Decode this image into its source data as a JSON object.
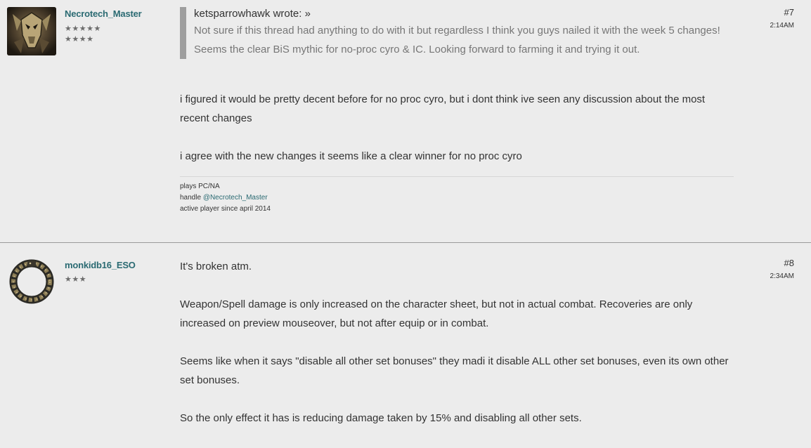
{
  "posts": [
    {
      "username": "Necrotech_Master",
      "rank_stars_row1": "★★★★★",
      "rank_stars_row2": "★★★★",
      "post_number": "#7",
      "time": "2:14AM",
      "quote": {
        "author": "ketsparrowhawk",
        "wrote": "wrote:",
        "arrow": "»",
        "text": "Not sure if this thread had anything to do with it but regardless I think you guys nailed it with the week 5 changes! Seems the clear BiS mythic for no-proc cyro & IC. Looking forward to farming it and trying it out."
      },
      "paragraphs": [
        "i figured it would be pretty decent before for no proc cyro, but i dont think ive seen any discussion about the most recent changes",
        "i agree with the new changes it seems like a clear winner for no proc cyro"
      ],
      "signature": {
        "line1": "plays PC/NA",
        "line2_prefix": "handle ",
        "line2_handle": "@Necrotech_Master",
        "line3": "active player since april 2014"
      }
    },
    {
      "username": "monkidb16_ESO",
      "rank_stars": "★★★",
      "post_number": "#8",
      "time": "2:34AM",
      "paragraphs": [
        "It's broken atm.",
        "Weapon/Spell damage is only increased on the character sheet, but not in actual combat. Recoveries are only increased on preview mouseover, but not after equip or in combat.",
        "Seems like when it says \"disable all other set bonuses\" they madi it disable ALL other set bonuses, even its own other set bonuses.",
        "So the only effect it has is reducing damage taken by 15% and disabling all other sets."
      ]
    }
  ],
  "colors": {
    "background": "#ececec",
    "username": "#2a6a72",
    "quote_bar": "#9e9e9e",
    "quote_text": "#777777"
  }
}
